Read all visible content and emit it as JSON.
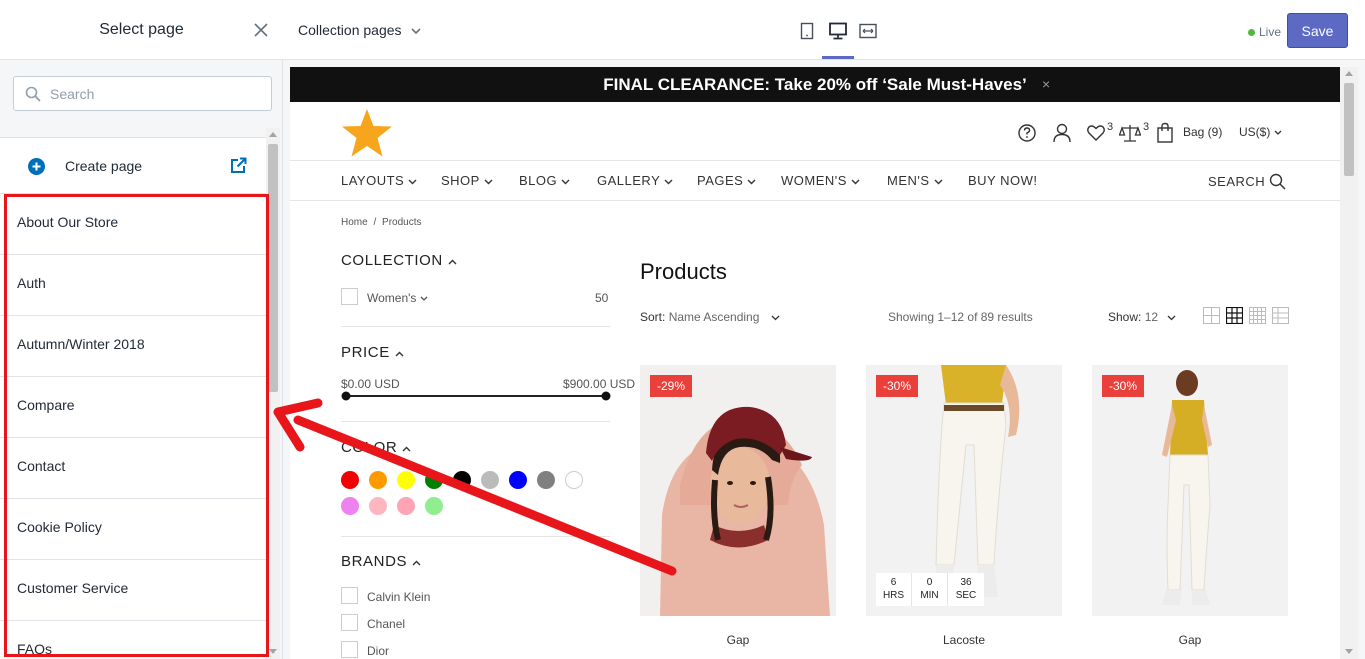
{
  "sidebar": {
    "title": "Select page",
    "search_placeholder": "Search",
    "create_label": "Create page",
    "pages": [
      "About Our Store",
      "Auth",
      "Autumn/Winter 2018",
      "Compare",
      "Contact",
      "Cookie Policy",
      "Customer Service",
      "FAQs"
    ]
  },
  "topbar": {
    "collection_label": "Collection pages",
    "live_label": "Live",
    "save_label": "Save"
  },
  "store": {
    "announcement": "FINAL CLEARANCE: Take 20% off ‘Sale Must-Haves’",
    "announcement_close": "×",
    "wishlist_count": "3",
    "compare_count": "3",
    "bag_label": "Bag (9)",
    "currency": "US($)",
    "nav": [
      "LAYOUTS",
      "SHOP",
      "BLOG",
      "GALLERY",
      "PAGES",
      "WOMEN'S",
      "MEN'S",
      "BUY NOW!"
    ],
    "search_label": "SEARCH",
    "breadcrumb": {
      "home": "Home",
      "sep": "/",
      "current": "Products"
    },
    "filters": {
      "collection_title": "COLLECTION",
      "collection_item": "Women's",
      "collection_count": "50",
      "price_title": "PRICE",
      "price_min": "$0.00 USD",
      "price_max": "$900.00 USD",
      "color_title": "COLOR",
      "brands_title": "BRANDS",
      "brands": [
        "Calvin Klein",
        "Chanel",
        "Dior"
      ]
    },
    "colors": [
      "#f00000",
      "#ff9900",
      "#ffff00",
      "#008000",
      "#000000",
      "#bbbbbb",
      "#0000ff",
      "#808080",
      "#ffffff",
      "#ee82ee",
      "#ffb6c1",
      "#ffa4b4",
      "#90ee90"
    ],
    "products_title": "Products",
    "sort_label": "Sort:",
    "sort_value": "Name Ascending",
    "showing": "Showing 1–12 of 89 results",
    "show_label": "Show:",
    "show_value": "12",
    "products": [
      {
        "badge": "-29%",
        "name": "Gap"
      },
      {
        "badge": "-30%",
        "name": "Lacoste"
      },
      {
        "badge": "-30%",
        "name": "Gap"
      }
    ],
    "countdown": [
      {
        "value": "6",
        "unit": "HRS"
      },
      {
        "value": "0",
        "unit": "MIN"
      },
      {
        "value": "36",
        "unit": "SEC"
      }
    ]
  }
}
